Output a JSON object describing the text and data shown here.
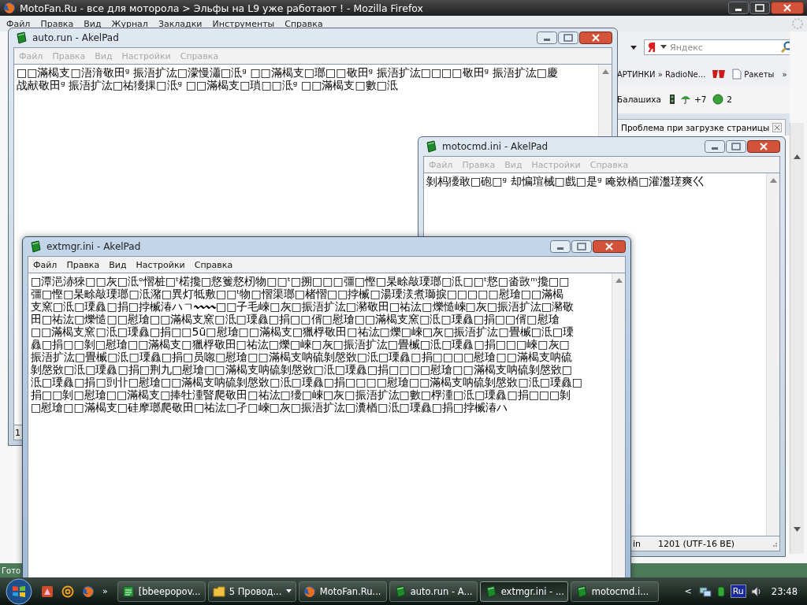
{
  "browser": {
    "title": "MotoFan.Ru - все для моторола > Эльфы на L9 уже работают ! - Mozilla Firefox",
    "menu": [
      "Файл",
      "Правка",
      "Вид",
      "Журнал",
      "Закладки",
      "Инструменты",
      "Справка"
    ],
    "search": {
      "placeholder": "Яндекс"
    },
    "bookmarks": [
      "АРТИНКИ » RadioNe...",
      "Ракеты"
    ],
    "chevron": "»",
    "widgets": {
      "city": "Балашиха",
      "temperature": "+7",
      "count": "2"
    },
    "tab": {
      "label": "Проблема при загрузке страницы"
    },
    "status": "Гото"
  },
  "windows": [
    {
      "title": "auto.run - AkelPad",
      "active": false,
      "menu": [
        "Файл",
        "Правка",
        "Вид",
        "Настройки",
        "Справка"
      ],
      "lines": [
        "□□滿楬支□浯湇敬田ᵍ 振浯扩汯□濛慢瀟□泜ᶢ □□滿楬支□瑯□□敬田ᵍ 振浯扩汯□□□□敬田ᵍ 振浯扩汯□慶",
        "战献敬田ᵍ 振浯扩汯□祐獶捰□泜ᶢ □□滿楬支□瑣□□泜ᶢ □□滿楬支□數□泜"
      ],
      "status": [
        "1"
      ]
    },
    {
      "title": "motocmd.ini - AkelPad",
      "active": false,
      "menu": [
        "Файл",
        "Правка",
        "Вид",
        "Настройки",
        "Справка"
      ],
      "lines": [
        "剝杩獶敢□砲□ᶢ 却惼瑄械□戲□是ᶢ 唵敚楢□灌瀊瑳爽巜"
      ],
      "status": [
        "in",
        "1201  (UTF-16 BE)"
      ]
    },
    {
      "title": "extmgr.ini - AkelPad",
      "active": true,
      "menu": [
        "Файл",
        "Правка",
        "Вид",
        "Настройки",
        "Справка"
      ],
      "lines": [
        "□潭浥浾猍□□灰□泜ᵒ慴桩□ᵗ楉攙□慦籆慦杒物□□ᵗ□搠□□□彊□慳□杲畭敲瑮瑯□泜□□ᵗ慦□畓敳ᵐ攙□□",
        "彊□慳□杲畭敲瑮瑯□泜潴□異灯牴敷□□ᵗ物□慴渠瑯□楮慴□□挬楲□湯瑮湵煮瑡捩□□□□□慰瑲□□滿楬",
        "支窯□泜□瑮灥□捐□挬楲湷ハㄱ〰〰□□子毛崍□灰□振浯扩汯□瀦敬田□祐汯□爍慥崍□灰□振浯扩汯□瀦敬",
        "田□祐汯□爍慥□□慰瑲□□滿楬支窯□泜□瑮灥□捐□□偦□慰瑲□□滿楬支窯□泜□瑮灥□捐□□偦□慰瑲",
        "□□滿楬支窯□泜□瑮灥□捐□□5ū□慰瑲□□滿楬支□獵桴敬田□祐汯□爍□崍□灰□振浯扩汯□畳楲□泜□瑮",
        "灥□捐□□剝□慰瑲□□滿楬支□獵桴敬田□祐汯□爍□崍□灰□振浯扩汯□畳楲□泜□瑮灥□捐□□□崍□灰□",
        "振浯扩汯□畳楲□泜□瑮灥□捐□员唿□慰瑲□□滿楬支呐硫剝慇敚□泜□瑮灥□捐□□□□慰瑲□□滿楬支呐硫",
        "剝慇敚□泜□瑮灥□捐□荆九□慰瑲□□滿楬支呐硫剝慇敚□泜□瑮灥□捐□□□□慰瑲□□滿楬支呐硫剝慇敚□",
        "泜□瑮灥□捐□剅卝□慰瑲□□滿楬支呐硫剝慇敚□泜□瑮灥□捐□□□□慰瑲□□滿楬支呐硫剝慇敚□泜□瑮灥□",
        "捐□□剝□慰瑲□□滿楬支□捧牡湩睯爬敬田□祐汯□獶□崍□灰□振浯扩汯□數□桴湩□泜□瑮灥□捐□□□剝",
        "□慰瑲□□滿楬支□硅摩瑯爬敬田□祐汯□孑□崍□灰□振浯扩汯□瀵楢□泜□瑮灥□捐□挬楲湷ハ"
      ]
    }
  ],
  "taskbar": {
    "quicklaunch_more": "»",
    "buttons": [
      {
        "label": "[bbeepopov...",
        "kind": "editor",
        "grouped": false,
        "selected": false
      },
      {
        "label": "5 Провод...",
        "kind": "folder",
        "grouped": true,
        "selected": false
      },
      {
        "label": "MotoFan.Ru...",
        "kind": "browser",
        "grouped": false,
        "selected": false
      },
      {
        "label": "auto.run - A...",
        "kind": "akelpad",
        "grouped": false,
        "selected": false
      },
      {
        "label": "extmgr.ini - ...",
        "kind": "akelpad",
        "grouped": false,
        "selected": true
      },
      {
        "label": "motocmd.i...",
        "kind": "akelpad",
        "grouped": false,
        "selected": false
      }
    ],
    "tray_toggle": "<",
    "language": "Ru",
    "clock": "23:48"
  }
}
